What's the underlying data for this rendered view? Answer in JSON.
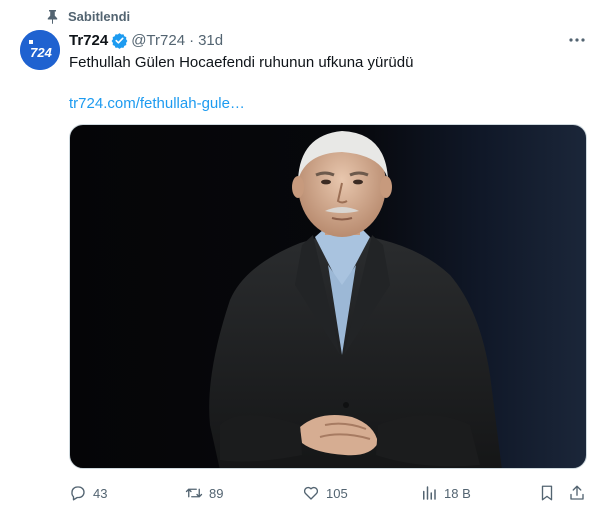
{
  "pinned": {
    "label": "Sabitlendi",
    "icon": "pin-icon"
  },
  "author": {
    "avatar_text": "724",
    "name": "Tr724",
    "verified": true,
    "handle": "@Tr724",
    "separator": "·",
    "time": "31d"
  },
  "tweet": {
    "text": "Fethullah Gülen Hocaefendi ruhunun ufkuna yürüdü",
    "link": "tr724.com/fethullah-gule…"
  },
  "actions": {
    "reply_count": "43",
    "retweet_count": "89",
    "like_count": "105",
    "views_count": "18 B"
  },
  "colors": {
    "accent": "#1d9bf0",
    "muted": "#536471",
    "text": "#0f1419",
    "avatar_bg": "#1f62d0"
  }
}
